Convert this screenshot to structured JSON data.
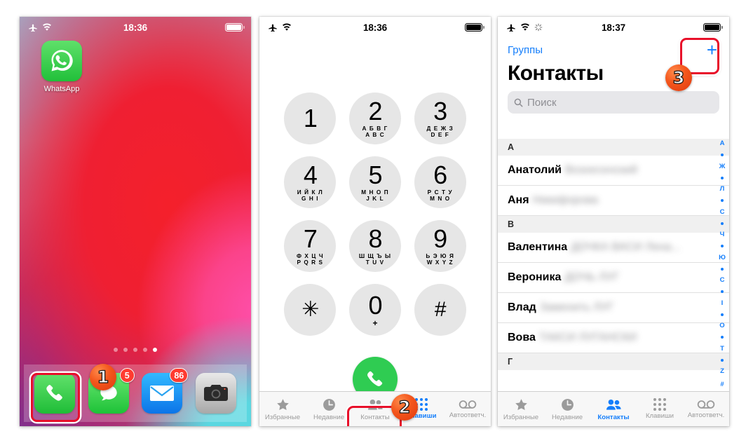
{
  "panels": {
    "home": {
      "status": {
        "time": "18:36",
        "icons": [
          "airplane-mode-icon",
          "wifi-icon"
        ],
        "battery": "full"
      },
      "apps": [
        {
          "name": "WhatsApp",
          "icon": "whatsapp-icon"
        }
      ],
      "page_dots": {
        "count": 5,
        "active_index": 4
      },
      "dock": [
        {
          "name": "Телефон",
          "icon": "phone-icon",
          "badge": ""
        },
        {
          "name": "Сообщения",
          "icon": "messages-icon",
          "badge": "5"
        },
        {
          "name": "Почта",
          "icon": "mail-icon",
          "badge": "86"
        },
        {
          "name": "Камера",
          "icon": "camera-icon",
          "badge": ""
        }
      ],
      "step": "1"
    },
    "keypad": {
      "status": {
        "time": "18:36",
        "icons": [
          "airplane-mode-icon",
          "wifi-icon"
        ],
        "battery": "full"
      },
      "keys": [
        {
          "digit": "1",
          "cyr": "",
          "lat": ""
        },
        {
          "digit": "2",
          "cyr": "А Б В Г",
          "lat": "A B C"
        },
        {
          "digit": "3",
          "cyr": "Д Е Ж З",
          "lat": "D E F"
        },
        {
          "digit": "4",
          "cyr": "И Й К Л",
          "lat": "G H I"
        },
        {
          "digit": "5",
          "cyr": "М Н О П",
          "lat": "J K L"
        },
        {
          "digit": "6",
          "cyr": "Р С Т У",
          "lat": "M N O"
        },
        {
          "digit": "7",
          "cyr": "Ф Х Ц Ч",
          "lat": "P Q R S"
        },
        {
          "digit": "8",
          "cyr": "Ш Щ Ъ Ы",
          "lat": "T U V"
        },
        {
          "digit": "9",
          "cyr": "Ь Э Ю Я",
          "lat": "W X Y Z"
        },
        {
          "digit": "✳",
          "cyr": "",
          "lat": ""
        },
        {
          "digit": "0",
          "cyr": "+",
          "lat": ""
        },
        {
          "digit": "#",
          "cyr": "",
          "lat": ""
        }
      ],
      "call_button": "call-icon",
      "tabs": [
        {
          "label": "Избранные",
          "icon": "star-icon",
          "active": false
        },
        {
          "label": "Недавние",
          "icon": "clock-icon",
          "active": false
        },
        {
          "label": "Контакты",
          "icon": "contacts-icon",
          "active": false
        },
        {
          "label": "Клавиши",
          "icon": "keypad-icon",
          "active": true
        },
        {
          "label": "Автоответч.",
          "icon": "voicemail-icon",
          "active": false
        }
      ],
      "step": "2"
    },
    "contacts": {
      "status": {
        "time": "18:37",
        "icons": [
          "airplane-mode-icon",
          "wifi-icon",
          "sync-icon"
        ],
        "battery": "full"
      },
      "nav_back": "Группы",
      "add_button": "+",
      "title": "Контакты",
      "search_placeholder": "Поиск",
      "sections": [
        {
          "letter": "А",
          "rows": [
            {
              "first": "Анатолий",
              "last": "Вознесенский"
            },
            {
              "first": "Аня",
              "last": "Никифорова"
            }
          ]
        },
        {
          "letter": "В",
          "rows": [
            {
              "first": "Валентина",
              "last": "ДОЧКА ВАСИ Лена..."
            },
            {
              "first": "Вероника",
              "last": "ДОЧЬ ЛУГ"
            },
            {
              "first": "Влад",
              "last": "Заменить ЛУГ"
            },
            {
              "first": "Вова",
              "last": "ТАКСИ ЛУГАНСКИ"
            }
          ]
        },
        {
          "letter": "Г",
          "rows": []
        }
      ],
      "index": [
        "А",
        "•",
        "Ж",
        "•",
        "Л",
        "•",
        "С",
        "•",
        "Ч",
        "•",
        "Ю",
        "•",
        "C",
        "•",
        "I",
        "•",
        "O",
        "•",
        "T",
        "•",
        "Z",
        "#"
      ],
      "tabs": [
        {
          "label": "Избранные",
          "icon": "star-icon",
          "active": false
        },
        {
          "label": "Недавние",
          "icon": "clock-icon",
          "active": false
        },
        {
          "label": "Контакты",
          "icon": "contacts-icon",
          "active": true
        },
        {
          "label": "Клавиши",
          "icon": "keypad-icon",
          "active": false
        },
        {
          "label": "Автоответч.",
          "icon": "voicemail-icon",
          "active": false
        }
      ],
      "step": "3"
    }
  },
  "colors": {
    "accent_blue": "#147efb",
    "highlight_red": "#e8102a",
    "badge_red": "#ff3b30",
    "call_green": "#2fcc52",
    "step_orange": "#f4571d"
  }
}
